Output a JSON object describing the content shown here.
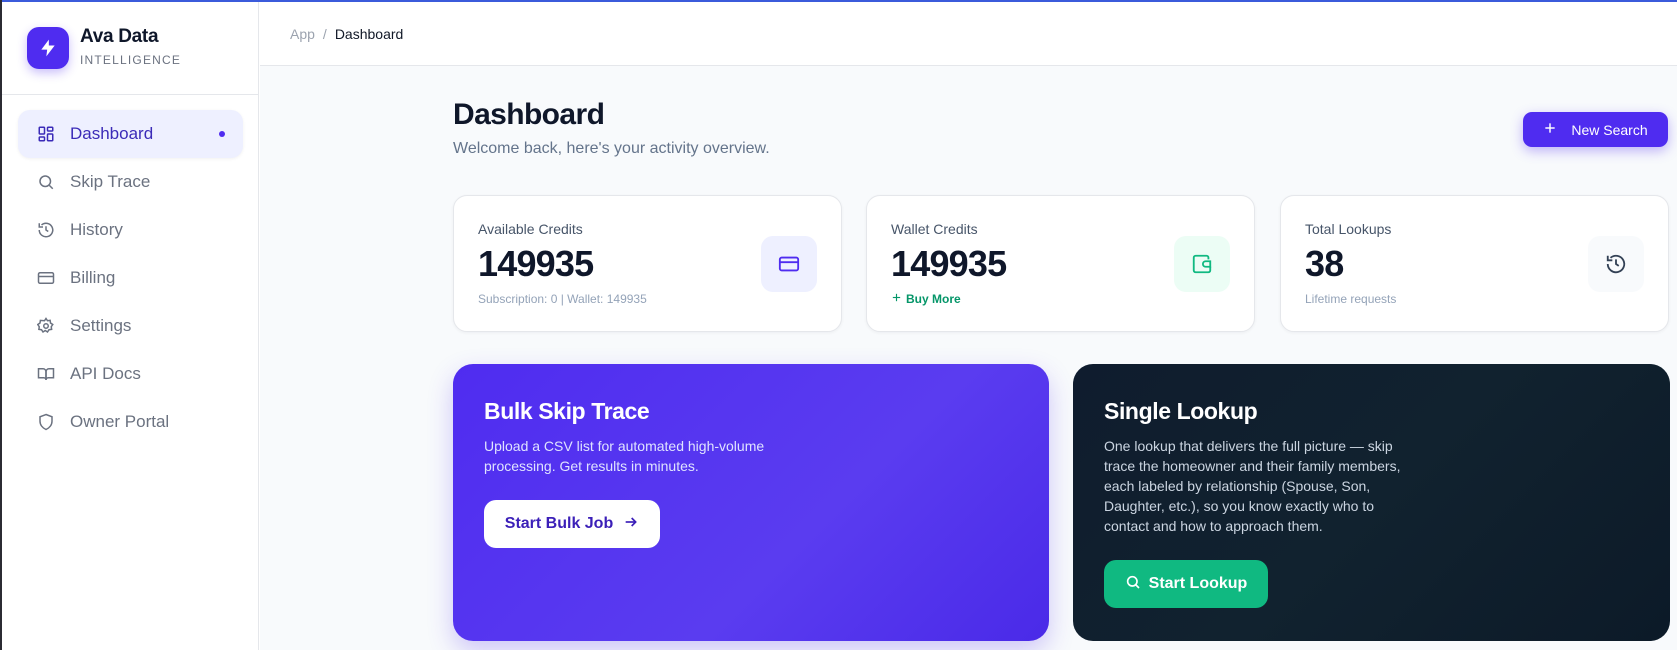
{
  "brand": {
    "name": "Ava Data",
    "subtitle": "INTELLIGENCE"
  },
  "sidebar": {
    "items": [
      {
        "label": "Dashboard",
        "icon": "grid-icon",
        "active": true
      },
      {
        "label": "Skip Trace",
        "icon": "search-icon"
      },
      {
        "label": "History",
        "icon": "history-icon"
      },
      {
        "label": "Billing",
        "icon": "credit-card-icon"
      },
      {
        "label": "Settings",
        "icon": "gear-icon"
      },
      {
        "label": "API Docs",
        "icon": "book-icon"
      },
      {
        "label": "Owner Portal",
        "icon": "shield-icon"
      }
    ]
  },
  "breadcrumb": {
    "root": "App",
    "separator": "/",
    "current": "Dashboard"
  },
  "page": {
    "title": "Dashboard",
    "subtitle": "Welcome back, here's your activity overview.",
    "new_search_label": "New Search"
  },
  "stats": [
    {
      "label": "Available Credits",
      "value": "149935",
      "footer": "Subscription: 0 | Wallet: 149935",
      "icon": "credit-card-icon"
    },
    {
      "label": "Wallet Credits",
      "value": "149935",
      "footer": "Buy More",
      "icon": "wallet-icon"
    },
    {
      "label": "Total Lookups",
      "value": "38",
      "footer": "Lifetime requests",
      "icon": "history-icon"
    }
  ],
  "bulk": {
    "title": "Bulk Skip Trace",
    "line1": "Upload a CSV list for automated high-volume",
    "line2": "processing. Get results in minutes.",
    "button": "Start Bulk Job"
  },
  "single": {
    "title": "Single Lookup",
    "line1": "One lookup that delivers the full picture — skip",
    "line2": "trace the homeowner and their family members,",
    "line3": "each labeled by relationship (Spouse, Son,",
    "line4": "Daughter, etc.), so you know exactly who to",
    "line5": "contact and how to approach them.",
    "button": "Start Lookup"
  },
  "colors": {
    "accent": "#4f2cf0",
    "success": "#10b981",
    "dark": "#0f1c2e"
  }
}
